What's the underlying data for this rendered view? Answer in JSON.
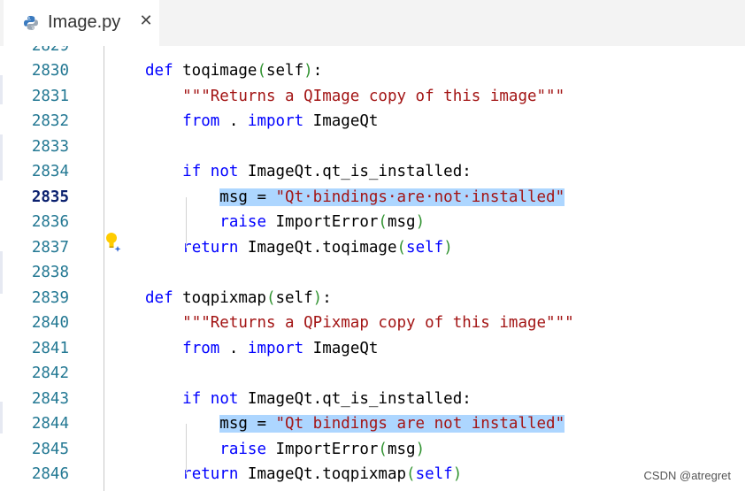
{
  "tab": {
    "title": "Image.py",
    "close_label": "✕",
    "icon": "python-icon"
  },
  "gutter": {
    "partial_line": "2829"
  },
  "lines": [
    {
      "num": "2830",
      "tokens": [
        {
          "t": "def",
          "c": "#0000ff"
        },
        {
          "t": " toqimage",
          "c": "#000000"
        },
        {
          "t": "(",
          "c": "#319331"
        },
        {
          "t": "self",
          "c": "#000000"
        },
        {
          "t": ")",
          "c": "#319331"
        },
        {
          "t": ":",
          "c": "#000000"
        }
      ]
    },
    {
      "num": "2831",
      "tokens": [
        {
          "t": "    ",
          "c": "#000000"
        },
        {
          "t": "\"\"\"Returns a QImage copy of this image\"\"\"",
          "c": "#a31515"
        }
      ]
    },
    {
      "num": "2832",
      "tokens": [
        {
          "t": "    ",
          "c": "#000000"
        },
        {
          "t": "from",
          "c": "#0000ff"
        },
        {
          "t": " . ",
          "c": "#000000"
        },
        {
          "t": "import",
          "c": "#0000ff"
        },
        {
          "t": " ImageQt",
          "c": "#000000"
        }
      ]
    },
    {
      "num": "2833",
      "tokens": []
    },
    {
      "num": "2834",
      "tokens": [
        {
          "t": "    ",
          "c": "#000000"
        },
        {
          "t": "if",
          "c": "#0000ff"
        },
        {
          "t": " ",
          "c": "#000000"
        },
        {
          "t": "not",
          "c": "#0000ff"
        },
        {
          "t": " ImageQt.qt_is_installed:",
          "c": "#000000"
        }
      ]
    },
    {
      "num": "2835",
      "active": true,
      "tokens": [
        {
          "t": "        ",
          "c": "#000000"
        },
        {
          "t": "msg = ",
          "c": "#000000",
          "sel": true
        },
        {
          "t": "\"Qt·bindings·are·not·installed\"",
          "c": "#a31515",
          "sel": true
        }
      ]
    },
    {
      "num": "2836",
      "tokens": [
        {
          "t": "        ",
          "c": "#000000"
        },
        {
          "t": "raise",
          "c": "#0000ff"
        },
        {
          "t": " ImportError",
          "c": "#000000"
        },
        {
          "t": "(",
          "c": "#319331"
        },
        {
          "t": "msg",
          "c": "#000000"
        },
        {
          "t": ")",
          "c": "#319331"
        }
      ]
    },
    {
      "num": "2837",
      "tokens": [
        {
          "t": "    ",
          "c": "#000000"
        },
        {
          "t": "return",
          "c": "#0000ff"
        },
        {
          "t": " ImageQt.toqimage",
          "c": "#000000"
        },
        {
          "t": "(",
          "c": "#319331"
        },
        {
          "t": "self",
          "c": "#0000ff"
        },
        {
          "t": ")",
          "c": "#319331"
        }
      ]
    },
    {
      "num": "2838",
      "tokens": []
    },
    {
      "num": "2839",
      "tokens": [
        {
          "t": "def",
          "c": "#0000ff"
        },
        {
          "t": " toqpixmap",
          "c": "#000000"
        },
        {
          "t": "(",
          "c": "#319331"
        },
        {
          "t": "self",
          "c": "#000000"
        },
        {
          "t": ")",
          "c": "#319331"
        },
        {
          "t": ":",
          "c": "#000000"
        }
      ]
    },
    {
      "num": "2840",
      "tokens": [
        {
          "t": "    ",
          "c": "#000000"
        },
        {
          "t": "\"\"\"Returns a QPixmap copy of this image\"\"\"",
          "c": "#a31515"
        }
      ]
    },
    {
      "num": "2841",
      "tokens": [
        {
          "t": "    ",
          "c": "#000000"
        },
        {
          "t": "from",
          "c": "#0000ff"
        },
        {
          "t": " . ",
          "c": "#000000"
        },
        {
          "t": "import",
          "c": "#0000ff"
        },
        {
          "t": " ImageQt",
          "c": "#000000"
        }
      ]
    },
    {
      "num": "2842",
      "tokens": []
    },
    {
      "num": "2843",
      "tokens": [
        {
          "t": "    ",
          "c": "#000000"
        },
        {
          "t": "if",
          "c": "#0000ff"
        },
        {
          "t": " ",
          "c": "#000000"
        },
        {
          "t": "not",
          "c": "#0000ff"
        },
        {
          "t": " ImageQt.qt_is_installed:",
          "c": "#000000"
        }
      ]
    },
    {
      "num": "2844",
      "tokens": [
        {
          "t": "        ",
          "c": "#000000"
        },
        {
          "t": "msg = ",
          "c": "#000000",
          "sel": true
        },
        {
          "t": "\"Qt bindings are not installed\"",
          "c": "#a31515",
          "sel": true
        }
      ]
    },
    {
      "num": "2845",
      "tokens": [
        {
          "t": "        ",
          "c": "#000000"
        },
        {
          "t": "raise",
          "c": "#0000ff"
        },
        {
          "t": " ImportError",
          "c": "#000000"
        },
        {
          "t": "(",
          "c": "#319331"
        },
        {
          "t": "msg",
          "c": "#000000"
        },
        {
          "t": ")",
          "c": "#319331"
        }
      ]
    },
    {
      "num": "2846",
      "tokens": [
        {
          "t": "    ",
          "c": "#000000"
        },
        {
          "t": "return",
          "c": "#0000ff"
        },
        {
          "t": " ImageQt.toqpixmap",
          "c": "#000000"
        },
        {
          "t": "(",
          "c": "#319331"
        },
        {
          "t": "self",
          "c": "#0000ff"
        },
        {
          "t": ")",
          "c": "#319331"
        }
      ]
    }
  ],
  "lightbulb": {
    "icon": "lightbulb-sparkle-icon",
    "color": "#ffcc00"
  },
  "watermark": "CSDN @atregret"
}
